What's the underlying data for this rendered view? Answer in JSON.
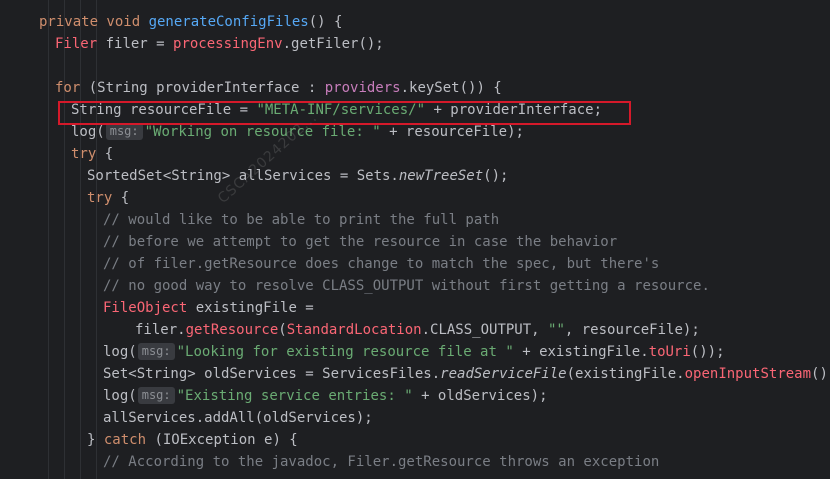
{
  "code": {
    "l1": {
      "kw": "private void ",
      "fn": "generateConfigFiles",
      "rest": "() {"
    },
    "l2": {
      "type": "Filer",
      "mid": " filer = ",
      "fld": "processingEnv",
      "rest": ".getFiler();"
    },
    "l3": {
      "kw": "for",
      "a": " (String providerInterface : ",
      "fld": "providers",
      "b": ".keySet()) {"
    },
    "l4": {
      "a": "String resourceFile = ",
      "str": "\"META-INF/services/\"",
      "b": " + providerInterface;"
    },
    "l5": {
      "a": "log(",
      "hint": "msg:",
      "str": "\"Working on resource file: \"",
      "b": " + resourceFile);"
    },
    "l6": {
      "kw": "try",
      "b": " {"
    },
    "l7": {
      "a": "SortedSet<String> allServices = Sets.",
      "it": "newTreeSet",
      "b": "();"
    },
    "l8": {
      "kw": "try",
      "b": " {"
    },
    "l9": "// would like to be able to print the full path",
    "l10": "// before we attempt to get the resource in case the behavior",
    "l11": "// of filer.getResource does change to match the spec, but there's",
    "l12": "// no good way to resolve CLASS_OUTPUT without first getting a resource.",
    "l13": {
      "type": "FileObject",
      "b": " existingFile ="
    },
    "l14": {
      "a": "filer.",
      "fn": "getResource",
      "p": "(",
      "type": "StandardLocation",
      "b": ".CLASS_OUTPUT, ",
      "str": "\"\"",
      "c": ", resourceFile);"
    },
    "l15": {
      "a": "log(",
      "hint": "msg:",
      "str": "\"Looking for existing resource file at \"",
      "b": " + existingFile.",
      "fn": "toUri",
      "c": "());"
    },
    "l16": {
      "a": "Set<String> oldServices = ServicesFiles.",
      "it": "readServiceFile",
      "b": "(existingFile.",
      "fn": "openInputStream",
      "c": "());"
    },
    "l17": {
      "a": "log(",
      "hint": "msg:",
      "str": "\"Existing service entries: \"",
      "b": " + oldServices);"
    },
    "l18": {
      "a": "allServices.addAll(oldServices);"
    },
    "l19": {
      "a": "} ",
      "kw": "catch",
      "b": " (IOException e) {"
    },
    "l20": "// According to the javadoc, Filer.getResource throws an exception"
  },
  "watermark": "CSCA2024202..."
}
